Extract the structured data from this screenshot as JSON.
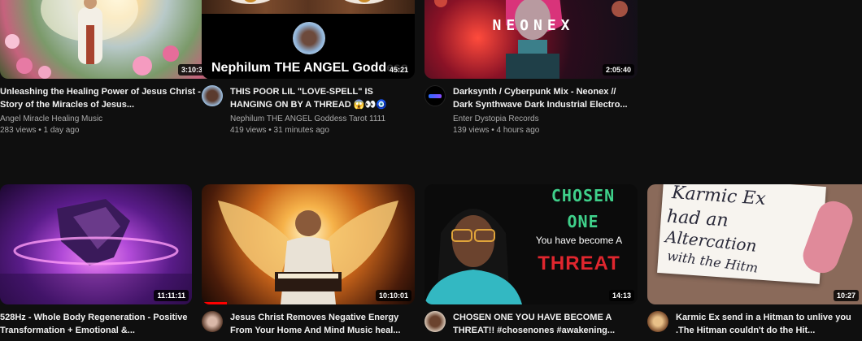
{
  "row1": [
    {
      "duration": "3:10:32",
      "title": "Unleashing the Healing Power of Jesus Christ - Story of the Miracles of Jesus...",
      "channel": "Angel Miracle Healing Music",
      "stats": "283 views • 1 day ago"
    },
    {
      "duration": "45:21",
      "overlay_text": "Nephilum THE ANGEL Goddess",
      "title": "THIS POOR LIL \"LOVE-SPELL\" IS HANGING ON BY A THREAD 😱👀🧿",
      "channel": "Nephilum THE ANGEL Goddess Tarot 1111",
      "stats": "419 views • 31 minutes ago"
    },
    {
      "duration": "2:05:40",
      "overlay_text": "NEONEX",
      "title": "Darksynth / Cyberpunk Mix - Neonex // Dark Synthwave Dark Industrial Electro...",
      "channel": "Enter Dystopia Records",
      "stats": "139 views • 4 hours ago"
    }
  ],
  "row2": [
    {
      "duration": "11:11:11",
      "title": "528Hz - Whole Body Regeneration - Positive Transformation + Emotional &..."
    },
    {
      "duration": "10:10:01",
      "title": "Jesus Christ Removes Negative Energy From Your Home And Mind Music heal..."
    },
    {
      "duration": "14:13",
      "overlay_line1": "CHOSEN",
      "overlay_line2": "ONE",
      "overlay_line3": "You have become A",
      "overlay_line4": "THREAT",
      "title": "CHOSEN ONE YOU HAVE BECOME A THREAT!! #chosenones #awakening..."
    },
    {
      "duration": "10:27",
      "overlay_line1": "Karmic Ex",
      "overlay_line2": "had an",
      "overlay_line3": "Altercation",
      "overlay_line4": "with the Hitm",
      "title": "Karmic Ex send in a Hitman to unlive you .The Hitman couldn't do the Hit..."
    }
  ],
  "colors": {
    "background": "#0f0f0f",
    "text_primary": "#f1f1f1",
    "text_secondary": "#aaaaaa",
    "progress_red": "#ff0000"
  }
}
